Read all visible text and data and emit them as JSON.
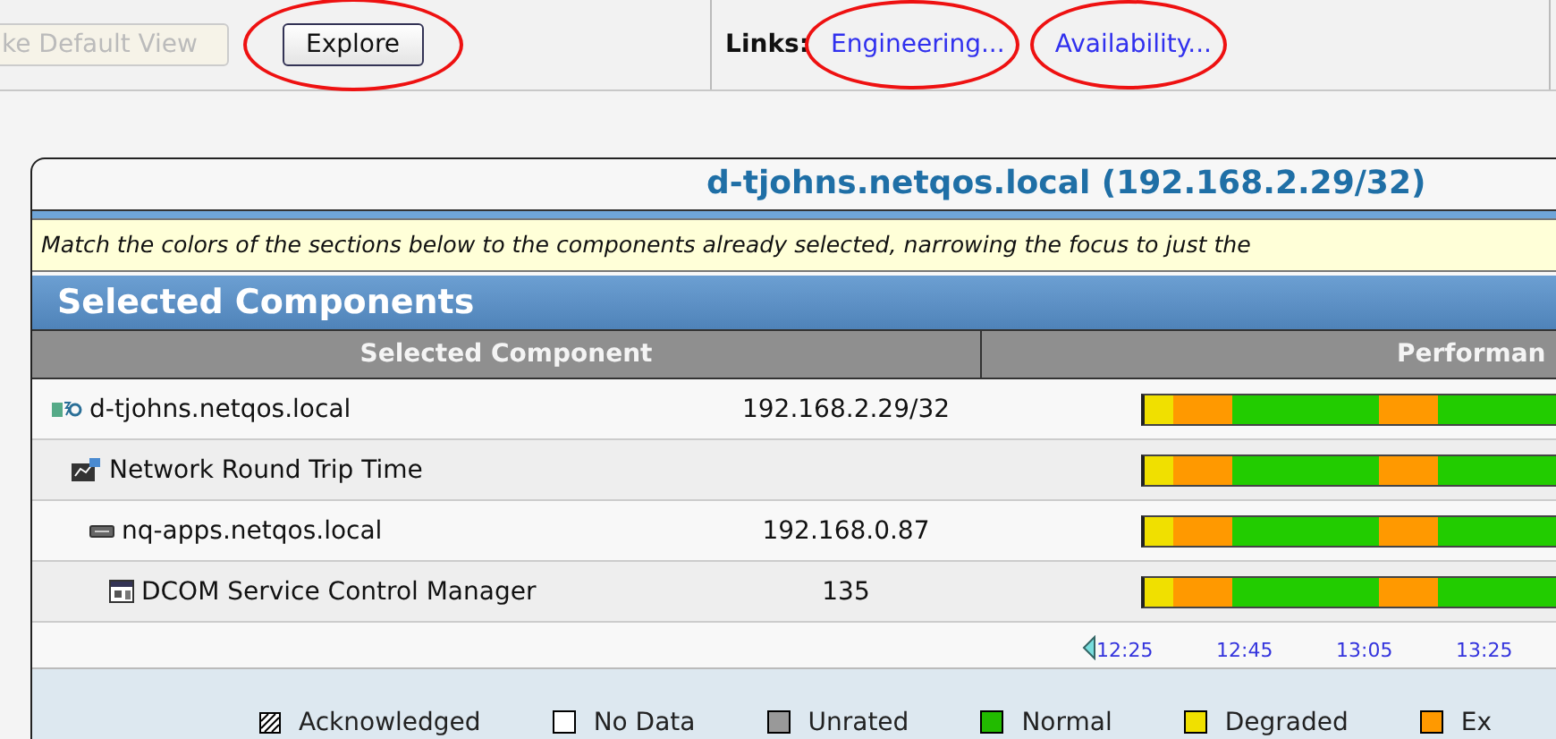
{
  "toolbar": {
    "default_view_button": {
      "label": "ke Default View",
      "disabled": true
    },
    "explore_button": {
      "label": "Explore",
      "circled": true
    },
    "links_label": "Links:",
    "links": [
      {
        "label": "Engineering...",
        "circled": true
      },
      {
        "label": "Availability...",
        "circled": true
      }
    ]
  },
  "panel": {
    "title": "d-tjohns.netqos.local (192.168.2.29/32)",
    "note": "Match the colors of the sections below to the components already selected, narrowing the focus to just the",
    "section_title": "Selected Components",
    "columns": [
      "Selected Component",
      "Performan"
    ],
    "rows": [
      {
        "kind": "host",
        "name": "d-tjohns.netqos.local",
        "address": "192.168.2.29/32",
        "segments": [
          {
            "color": "#f0e000"
          },
          {
            "color": "#ff9900"
          },
          {
            "color": "#ff9900"
          },
          {
            "color": "#22cc00"
          },
          {
            "color": "#22cc00"
          },
          {
            "color": "#22cc00"
          },
          {
            "color": "#22cc00"
          },
          {
            "color": "#22cc00"
          },
          {
            "color": "#ff9900"
          },
          {
            "color": "#ff9900"
          },
          {
            "color": "#22cc00"
          },
          {
            "color": "#22cc00"
          },
          {
            "color": "#22cc00"
          },
          {
            "color": "#22cc00"
          }
        ],
        "children": [
          {
            "kind": "metric",
            "name": "Network Round Trip Time",
            "segments": [
              {
                "color": "#f0e000"
              },
              {
                "color": "#ff9900"
              },
              {
                "color": "#ff9900"
              },
              {
                "color": "#22cc00"
              },
              {
                "color": "#22cc00"
              },
              {
                "color": "#22cc00"
              },
              {
                "color": "#22cc00"
              },
              {
                "color": "#22cc00"
              },
              {
                "color": "#ff9900"
              },
              {
                "color": "#ff9900"
              },
              {
                "color": "#22cc00"
              },
              {
                "color": "#22cc00"
              },
              {
                "color": "#22cc00"
              },
              {
                "color": "#22cc00"
              }
            ],
            "children": [
              {
                "kind": "server",
                "name": "nq-apps.netqos.local",
                "address": "192.168.0.87",
                "segments": [
                  {
                    "color": "#f0e000"
                  },
                  {
                    "color": "#ff9900"
                  },
                  {
                    "color": "#ff9900"
                  },
                  {
                    "color": "#22cc00"
                  },
                  {
                    "color": "#22cc00"
                  },
                  {
                    "color": "#22cc00"
                  },
                  {
                    "color": "#22cc00"
                  },
                  {
                    "color": "#22cc00"
                  },
                  {
                    "color": "#ff9900"
                  },
                  {
                    "color": "#ff9900"
                  },
                  {
                    "color": "#22cc00"
                  },
                  {
                    "color": "#22cc00"
                  },
                  {
                    "color": "#22cc00"
                  },
                  {
                    "color": "#22cc00"
                  }
                ],
                "children": [
                  {
                    "kind": "service",
                    "name": "DCOM Service Control Manager",
                    "address": "135",
                    "segments": [
                      {
                        "color": "#f0e000"
                      },
                      {
                        "color": "#ff9900"
                      },
                      {
                        "color": "#ff9900"
                      },
                      {
                        "color": "#22cc00"
                      },
                      {
                        "color": "#22cc00"
                      },
                      {
                        "color": "#22cc00"
                      },
                      {
                        "color": "#22cc00"
                      },
                      {
                        "color": "#22cc00"
                      },
                      {
                        "color": "#ff9900"
                      },
                      {
                        "color": "#ff9900"
                      },
                      {
                        "color": "#22cc00"
                      },
                      {
                        "color": "#22cc00"
                      },
                      {
                        "color": "#22cc00"
                      },
                      {
                        "color": "#22cc00"
                      }
                    ]
                  }
                ]
              }
            ]
          }
        ]
      }
    ],
    "timeline": [
      "12:25",
      "12:45",
      "13:05",
      "13:25"
    ],
    "legend": [
      {
        "kind": "hatched",
        "label": "Acknowledged",
        "color": "#ffffff"
      },
      {
        "kind": "solid",
        "label": "No Data",
        "color": "#ffffff"
      },
      {
        "kind": "solid",
        "label": "Unrated",
        "color": "#999999"
      },
      {
        "kind": "solid",
        "label": "Normal",
        "color": "#22bb00"
      },
      {
        "kind": "solid",
        "label": "Degraded",
        "color": "#f0e000"
      },
      {
        "kind": "solid",
        "label": "Ex",
        "color": "#ff9900"
      }
    ]
  }
}
